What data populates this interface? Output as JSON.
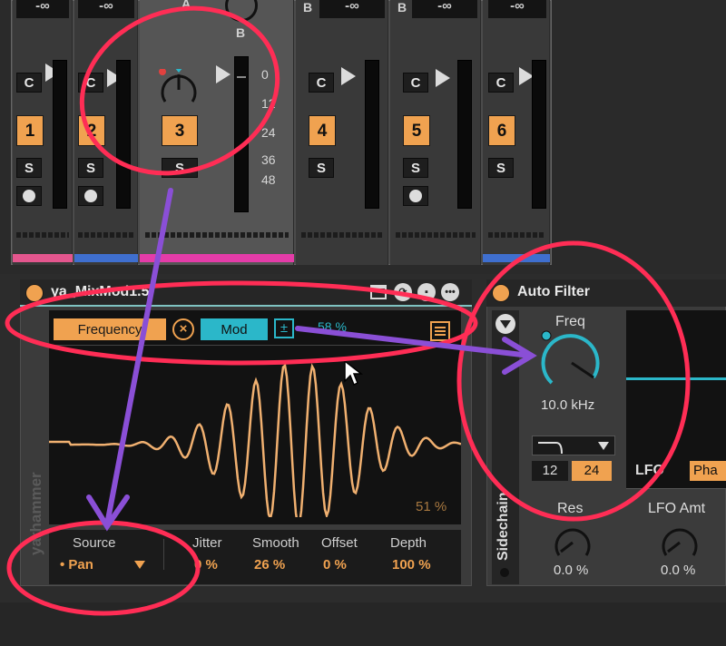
{
  "mixer": {
    "strips": [
      {
        "db": "-∞",
        "num": "1",
        "monitor": "C",
        "solo": "S",
        "color": "#e4568e"
      },
      {
        "db": "-∞",
        "num": "2",
        "monitor": "C",
        "solo": "S",
        "color": "#3f6fcf"
      },
      {
        "db": "",
        "num": "3",
        "monitor": "",
        "solo": "S",
        "color": "#e43ca8",
        "crossfade": "A"
      },
      {
        "db": "-∞",
        "num": "4",
        "monitor": "C",
        "solo": "S",
        "color": "",
        "crossfade": "B"
      },
      {
        "db": "-∞",
        "num": "5",
        "monitor": "C",
        "solo": "S",
        "color": "",
        "crossfade": "B"
      },
      {
        "db": "-∞",
        "num": "6",
        "monitor": "C",
        "solo": "S",
        "color": "#3f6fcf"
      }
    ],
    "scale": [
      "0",
      "12",
      "24",
      "36",
      "48"
    ],
    "crossfade_letter_3b": "B"
  },
  "device": {
    "title": "ya_MixMod1.5",
    "vertical_label": "yarhammer",
    "target": "Frequency",
    "mod_button": "Mod",
    "mod_sign": "±",
    "mod_percent": "58 %",
    "x_symbol": "×",
    "output_percent": "51 %",
    "source_label": "Source",
    "source_value": "• Pan",
    "params": [
      {
        "label": "Jitter",
        "value": "0 %"
      },
      {
        "label": "Smooth",
        "value": "26 %"
      },
      {
        "label": "Offset",
        "value": "0 %"
      },
      {
        "label": "Depth",
        "value": "100 %"
      }
    ]
  },
  "autofilter": {
    "title": "Auto Filter",
    "sidechain": "Sidechain",
    "freq_label": "Freq",
    "freq_value": "10.0 kHz",
    "slope_12": "12",
    "slope_24": "24",
    "lfo_label": "LFO",
    "phase_label": "Pha",
    "res_label": "Res",
    "res_value": "0.0 %",
    "lfo_amt_label": "LFO Amt",
    "lfo_amt_value": "0.0 %"
  },
  "colors": {
    "accent": "#f0a250",
    "cyan": "#2bb7c9",
    "annotation": "#ff2d55",
    "arrow": "#8a4fd6"
  }
}
